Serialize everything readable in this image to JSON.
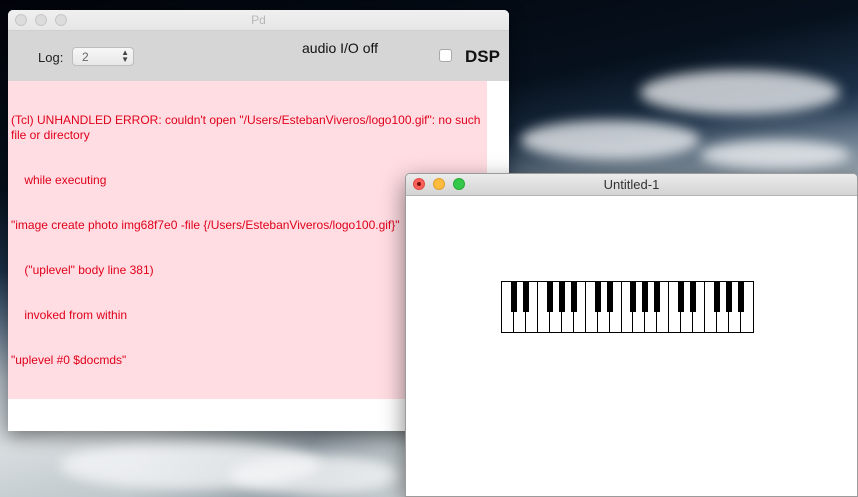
{
  "pd_window": {
    "title": "Pd",
    "log_label": "Log:",
    "log_value": "2",
    "audio_status": "audio I/O off",
    "dsp_label": "DSP",
    "dsp_checked": false,
    "console_lines": [
      "(Tcl) UNHANDLED ERROR: couldn't open \"/Users/EstebanViveros/logo100.gif\": no such file or directory",
      "    while executing",
      "\"image create photo img68f7e0 -file {/Users/EstebanViveros/logo100.gif}\"",
      "    (\"uplevel\" body line 381)",
      "    invoked from within",
      "\"uplevel #0 $docmds\""
    ]
  },
  "patch_window": {
    "title": "Untitled-1"
  },
  "colors": {
    "error_text": "#e0001a",
    "error_background": "#ffdde3",
    "close_red": "#fc605b",
    "minimize_yellow": "#fdbc40",
    "zoom_green": "#34c84a"
  }
}
